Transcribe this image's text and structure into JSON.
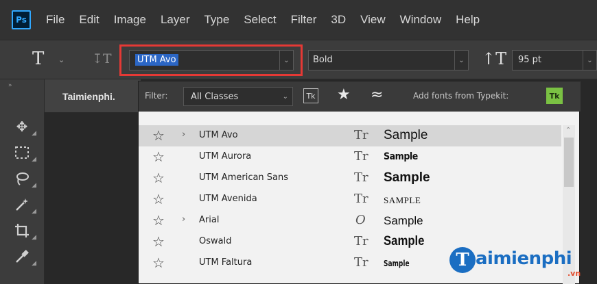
{
  "menubar": {
    "logo": "Ps",
    "items": [
      "File",
      "Edit",
      "Image",
      "Layer",
      "Type",
      "Select",
      "Filter",
      "3D",
      "View",
      "Window",
      "Help"
    ]
  },
  "options_bar": {
    "font_family": "UTM Avo",
    "font_style": "Bold",
    "font_size": "95 pt"
  },
  "document": {
    "tab_title": "Taimienphi."
  },
  "font_panel": {
    "filter_label": "Filter:",
    "classes_value": "All Classes",
    "typekit_filter_label": "Tk",
    "add_fonts_label": "Add fonts from Typekit:",
    "typekit_button_label": "Tk",
    "fonts": [
      {
        "name": "UTM Avo",
        "has_family": true,
        "type_glyph": "Tr",
        "sample": "Sample",
        "selected": true
      },
      {
        "name": "UTM Aurora",
        "has_family": false,
        "type_glyph": "Tr",
        "sample": "Sample",
        "selected": false
      },
      {
        "name": "UTM American Sans",
        "has_family": false,
        "type_glyph": "Tr",
        "sample": "Sample",
        "selected": false
      },
      {
        "name": "UTM Avenida",
        "has_family": false,
        "type_glyph": "Tr",
        "sample": "SAMPLE",
        "selected": false
      },
      {
        "name": "Arial",
        "has_family": true,
        "type_glyph": "O",
        "sample": "Sample",
        "selected": false
      },
      {
        "name": "Oswald",
        "has_family": false,
        "type_glyph": "Tr",
        "sample": "Sample",
        "selected": false
      },
      {
        "name": "UTM Faltura",
        "has_family": false,
        "type_glyph": "Tr",
        "sample": "Sample",
        "selected": false
      }
    ]
  },
  "watermark": {
    "logo_letter": "T",
    "text": "aimienphi",
    "suffix": ".vn"
  },
  "colors": {
    "accent_blue": "#2b66c5",
    "highlight_red": "#e53935",
    "typekit_green": "#7ac143",
    "watermark_blue": "#1b6ec2"
  }
}
